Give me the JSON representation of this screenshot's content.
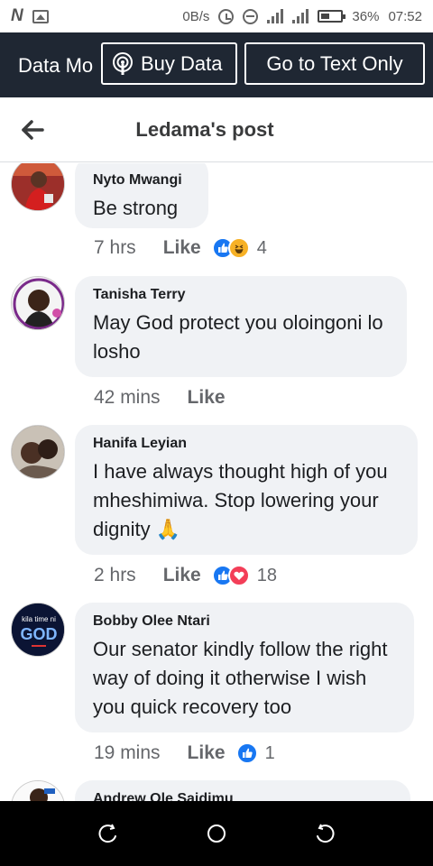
{
  "status_bar": {
    "speed": "0B/s",
    "battery": "36%",
    "time": "07:52",
    "icons": [
      "n-icon",
      "image-icon",
      "sync-icon",
      "dnd-icon",
      "signal-icon",
      "signal-icon",
      "battery-icon"
    ]
  },
  "data_banner": {
    "mode_label": "Data Mo",
    "buy_label": "Buy Data",
    "text_only_label": "Go to Text Only",
    "buy_icon": "podcast-icon"
  },
  "header": {
    "title": "Ledama's post",
    "back_icon": "arrow-left-icon"
  },
  "comments": [
    {
      "name": "Nyto Mwangi",
      "text": "Be strong",
      "time": "7 hrs",
      "like_label": "Like",
      "reactions": [
        "like",
        "haha"
      ],
      "count": "4"
    },
    {
      "name": "Tanisha Terry",
      "text": "May God protect you oloingoni lo losho",
      "time": "42 mins",
      "like_label": "Like",
      "reactions": [],
      "count": ""
    },
    {
      "name": "Hanifa Leyian",
      "text": "I have always thought high of you mheshimiwa. Stop lowering your dignity 🙏",
      "time": "2 hrs",
      "like_label": "Like",
      "reactions": [
        "like",
        "love"
      ],
      "count": "18"
    },
    {
      "name": "Bobby Olee Ntari",
      "text": "Our senator kindly follow the right way of doing it otherwise I wish you quick recovery too",
      "time": "19 mins",
      "like_label": "Like",
      "reactions": [
        "like"
      ],
      "count": "1"
    },
    {
      "name": "Andrew Ole Saidimu",
      "text": "",
      "time": "",
      "like_label": "",
      "reactions": [],
      "count": ""
    }
  ],
  "avatar_labels": {
    "bobby_line1": "kila time ni",
    "bobby_line2": "GOD"
  },
  "nav": [
    "recents-icon",
    "home-icon",
    "back-icon"
  ],
  "colors": {
    "banner_bg": "#1f2733",
    "bubble_bg": "#f0f2f5",
    "like_blue": "#1877f2",
    "love_red": "#f33e58",
    "haha_yellow": "#f7b125"
  }
}
